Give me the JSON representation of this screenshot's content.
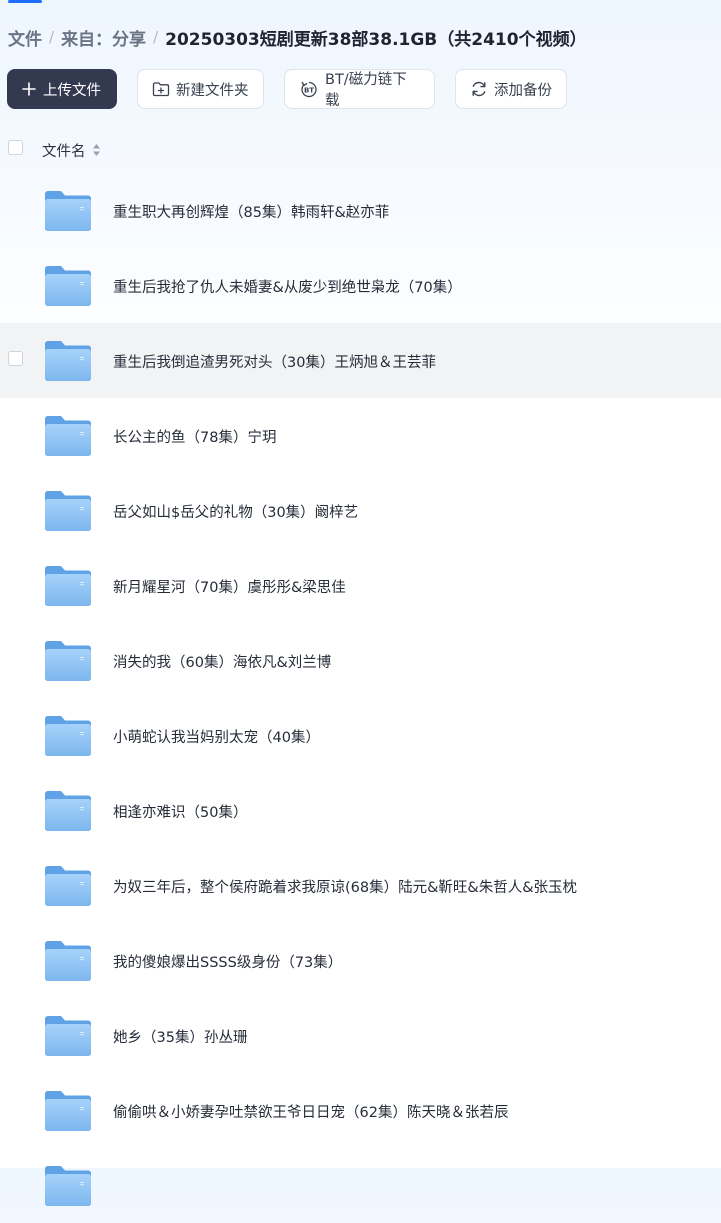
{
  "breadcrumb": {
    "items": [
      "文件",
      "来自：分享"
    ],
    "separator": "/",
    "current": "20250303短剧更新38部38.1GB（共2410个视频）"
  },
  "toolbar": {
    "upload_label": "上传文件",
    "new_folder_label": "新建文件夹",
    "bt_label": "BT/磁力链下载",
    "backup_label": "添加备份"
  },
  "list_header": {
    "filename_label": "文件名"
  },
  "files": [
    {
      "name": "重生职大再创辉煌（85集）韩雨轩&赵亦菲",
      "hovered": false
    },
    {
      "name": "重生后我抢了仇人未婚妻&从废少到绝世枭龙（70集）",
      "hovered": false
    },
    {
      "name": "重生后我倒追渣男死对头（30集）王炳旭＆王芸菲",
      "hovered": true
    },
    {
      "name": "长公主的鱼（78集）宁玥",
      "hovered": false
    },
    {
      "name": "岳父如山$岳父的礼物（30集）阚梓艺",
      "hovered": false
    },
    {
      "name": "新月耀星河（70集）虞彤彤&梁思佳",
      "hovered": false
    },
    {
      "name": "消失的我（60集）海依凡&刘兰博",
      "hovered": false
    },
    {
      "name": "小萌蛇认我当妈别太宠（40集）",
      "hovered": false
    },
    {
      "name": "相逢亦难识（50集）",
      "hovered": false
    },
    {
      "name": "为奴三年后，整个侯府跪着求我原谅(68集）陆元&靳旺&朱哲人&张玉枕",
      "hovered": false
    },
    {
      "name": "我的傻娘爆出SSSS级身份（73集）",
      "hovered": false
    },
    {
      "name": "她乡（35集）孙丛珊",
      "hovered": false
    },
    {
      "name": "偷偷哄＆小娇妻孕吐禁欲王爷日日宠（62集）陈天晓＆张若辰",
      "hovered": false
    },
    {
      "name": "",
      "hovered": false
    }
  ],
  "icons": {
    "folder": "folder-icon",
    "upload": "plus-icon",
    "new_folder": "folder-plus-icon",
    "bt": "bt-icon",
    "backup": "sync-icon",
    "sort": "sort-icon"
  },
  "colors": {
    "primary_button": "#333a4f",
    "accent": "#1f6fff",
    "folder": "#7db7ee",
    "hover_row": "#f2f3f5"
  }
}
